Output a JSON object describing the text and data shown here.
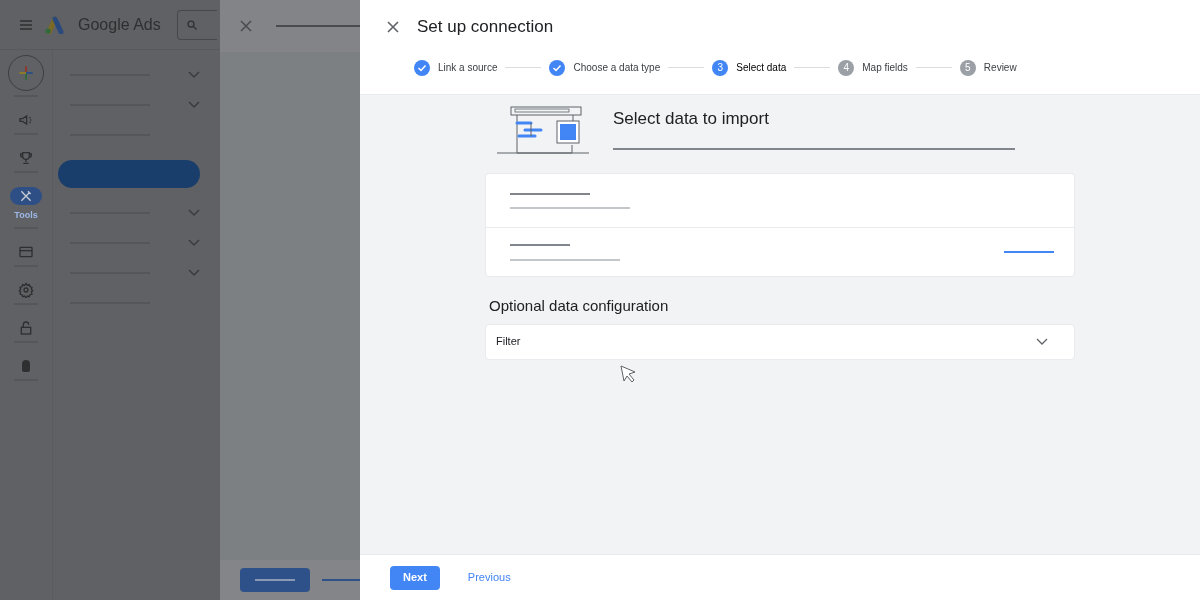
{
  "app": {
    "product_name": "Google Ads",
    "rail": [
      {
        "kind": "create",
        "selected": false
      },
      {
        "kind": "campaigns",
        "selected": false
      },
      {
        "kind": "goals",
        "selected": false
      },
      {
        "kind": "tools",
        "selected": true,
        "label": "Tools"
      },
      {
        "kind": "billing",
        "selected": false
      },
      {
        "kind": "settings",
        "selected": false
      },
      {
        "kind": "lock",
        "selected": false
      },
      {
        "kind": "android",
        "selected": false
      }
    ],
    "nav": [
      {
        "expandable": true,
        "selected": false
      },
      {
        "expandable": true,
        "selected": false
      },
      {
        "expandable": false,
        "selected": false
      },
      {
        "expandable": false,
        "selected": true
      },
      {
        "expandable": true,
        "selected": false
      },
      {
        "expandable": true,
        "selected": false
      },
      {
        "expandable": true,
        "selected": false
      },
      {
        "expandable": false,
        "selected": false
      }
    ]
  },
  "dialog": {
    "title": "Set up connection",
    "steps": [
      {
        "label": "Link a source",
        "done": true,
        "selected": false
      },
      {
        "label": "Choose a data type",
        "done": true,
        "selected": false
      },
      {
        "number": "3",
        "label": "Select data",
        "done": false,
        "selected": true
      },
      {
        "number": "4",
        "label": "Map fields",
        "done": false,
        "selected": false
      },
      {
        "number": "5",
        "label": "Review",
        "done": false,
        "selected": false
      }
    ],
    "heading": "Select data to import",
    "section_title": "Optional data configuration",
    "filter": {
      "label": "Filter",
      "expanded": false
    },
    "footer": {
      "primary": "Next",
      "secondary": "Previous"
    }
  }
}
